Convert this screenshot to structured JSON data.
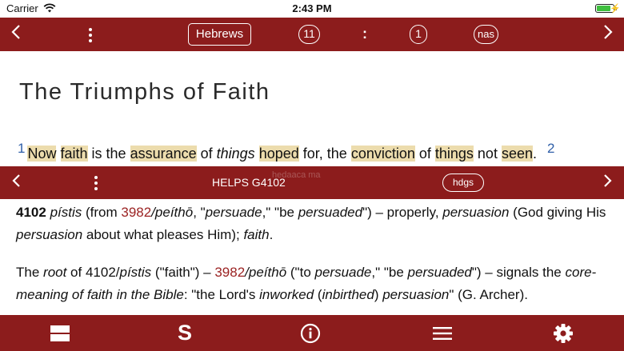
{
  "status_bar": {
    "carrier": "Carrier",
    "time": "2:43 PM",
    "battery_level": 0.85
  },
  "top_nav": {
    "book": "Hebrews",
    "chapter": "11",
    "separator": ":",
    "verse": "1",
    "version": "nas"
  },
  "reading": {
    "title": "The Triumphs of Faith",
    "verse_number": "1",
    "next_verse_number": "2",
    "segments": [
      {
        "text": "Now",
        "style": "hl"
      },
      {
        "text": " ",
        "style": ""
      },
      {
        "text": "faith",
        "style": "hl"
      },
      {
        "text": " is the ",
        "style": ""
      },
      {
        "text": "assurance",
        "style": "hl"
      },
      {
        "text": " of ",
        "style": ""
      },
      {
        "text": "things",
        "style": "ital"
      },
      {
        "text": " ",
        "style": ""
      },
      {
        "text": "hoped",
        "style": "hl"
      },
      {
        "text": " for, the ",
        "style": ""
      },
      {
        "text": "conviction",
        "style": "hl"
      },
      {
        "text": " of ",
        "style": ""
      },
      {
        "text": "things",
        "style": "hl"
      },
      {
        "text": " not ",
        "style": ""
      },
      {
        "text": "seen",
        "style": "hl"
      },
      {
        "text": ".",
        "style": ""
      }
    ]
  },
  "lexicon_bar": {
    "label": "HELPS G4102",
    "ghost_text": "hedaaca ma",
    "source": "hdgs"
  },
  "lexicon": {
    "para1": [
      {
        "text": "4102",
        "style": "b"
      },
      {
        "text": " ",
        "style": ""
      },
      {
        "text": "pístis",
        "style": "ital"
      },
      {
        "text": " (from ",
        "style": ""
      },
      {
        "text": "3982",
        "style": "red"
      },
      {
        "text": "/peíthō",
        "style": "ital"
      },
      {
        "text": ", \"",
        "style": ""
      },
      {
        "text": "persuade",
        "style": "ital"
      },
      {
        "text": ",\" \"be ",
        "style": ""
      },
      {
        "text": "persuaded",
        "style": "ital"
      },
      {
        "text": "\") – properly, ",
        "style": ""
      },
      {
        "text": "persuasion",
        "style": "ital"
      },
      {
        "text": " (God giving His ",
        "style": ""
      },
      {
        "text": "persuasion",
        "style": "ital"
      },
      {
        "text": " about what pleases Him); ",
        "style": ""
      },
      {
        "text": "faith",
        "style": "ital"
      },
      {
        "text": ".",
        "style": ""
      }
    ],
    "para2": [
      {
        "text": "The ",
        "style": ""
      },
      {
        "text": "root",
        "style": "ital"
      },
      {
        "text": " of 4102/",
        "style": ""
      },
      {
        "text": "pístis",
        "style": "ital"
      },
      {
        "text": " (\"faith\") – ",
        "style": ""
      },
      {
        "text": "3982",
        "style": "red"
      },
      {
        "text": "/peíthō",
        "style": "ital"
      },
      {
        "text": " (\"to ",
        "style": ""
      },
      {
        "text": "persuade",
        "style": "ital"
      },
      {
        "text": ",\" \"be ",
        "style": ""
      },
      {
        "text": "persuaded",
        "style": "ital"
      },
      {
        "text": "\") – signals the ",
        "style": ""
      },
      {
        "text": "core-meaning of faith in the Bible",
        "style": "ital"
      },
      {
        "text": ": \"the Lord's ",
        "style": ""
      },
      {
        "text": "inworked",
        "style": "ital"
      },
      {
        "text": " (",
        "style": ""
      },
      {
        "text": "inbirthed",
        "style": "ital"
      },
      {
        "text": ") ",
        "style": ""
      },
      {
        "text": "persuasion",
        "style": "ital"
      },
      {
        "text": "\" (G. Archer).",
        "style": ""
      }
    ]
  },
  "toolbar": {
    "strongs_letter": "S"
  },
  "colors": {
    "brand": "#8c1c1c",
    "highlight": "#ecdcad",
    "link_red": "#9b2323",
    "verse_blue": "#2f5fa8"
  },
  "icons": [
    "wifi-icon",
    "battery-icon",
    "chevron-left-icon",
    "chevron-right-icon",
    "more-vertical-icon",
    "split-view-icon",
    "strongs-icon",
    "info-icon",
    "menu-icon",
    "gear-icon"
  ]
}
